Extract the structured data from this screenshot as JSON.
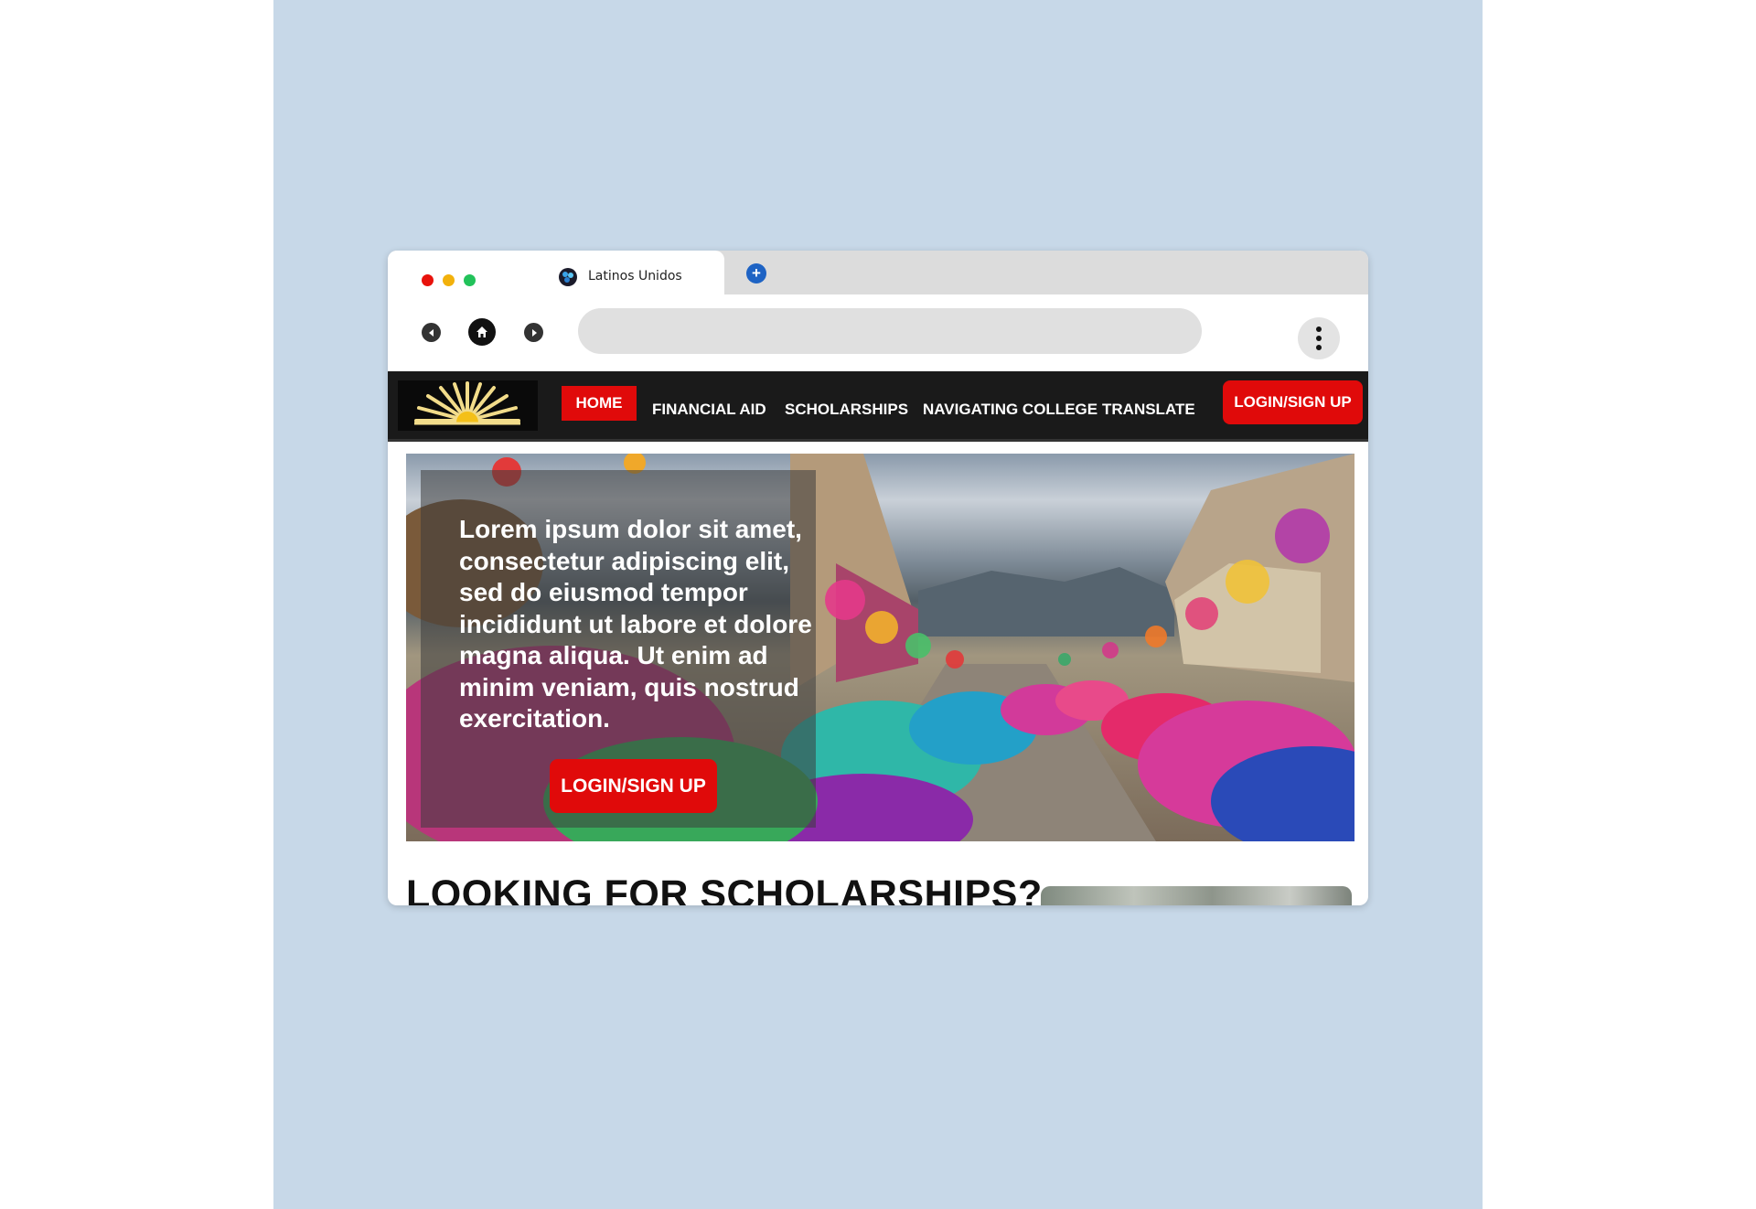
{
  "browser": {
    "tab_title": "Latinos Unidos",
    "new_tab_symbol": "+",
    "address_value": "",
    "icons": [
      "favicon-icon",
      "back-icon",
      "home-icon",
      "forward-icon",
      "more-menu-icon",
      "new-tab-icon"
    ]
  },
  "site": {
    "nav": {
      "home": "HOME",
      "financial_aid": "FINANCIAL AID",
      "scholarships": "SCHOLARSHIPS",
      "navigating_college": "NAVIGATING COLLEGE",
      "translate": "TRANSLATE",
      "login": "LOGIN/SIGN UP"
    },
    "hero": {
      "text": "Lorem ipsum dolor sit amet, consectetur adipiscing elit, sed do eiusmod tempor incididunt ut labore et dolore magna aliqua. Ut enim ad minim veniam, quis nostrud exercitation.",
      "button": "LOGIN/SIGN UP"
    },
    "section_heading": "LOOKING FOR SCHOLARSHIPS?",
    "colors": {
      "accent": "#e00a0a",
      "nav_background": "#1a1a1a",
      "page_backdrop": "#c7d8e8",
      "sun_logo": "#f2dc8a"
    }
  }
}
